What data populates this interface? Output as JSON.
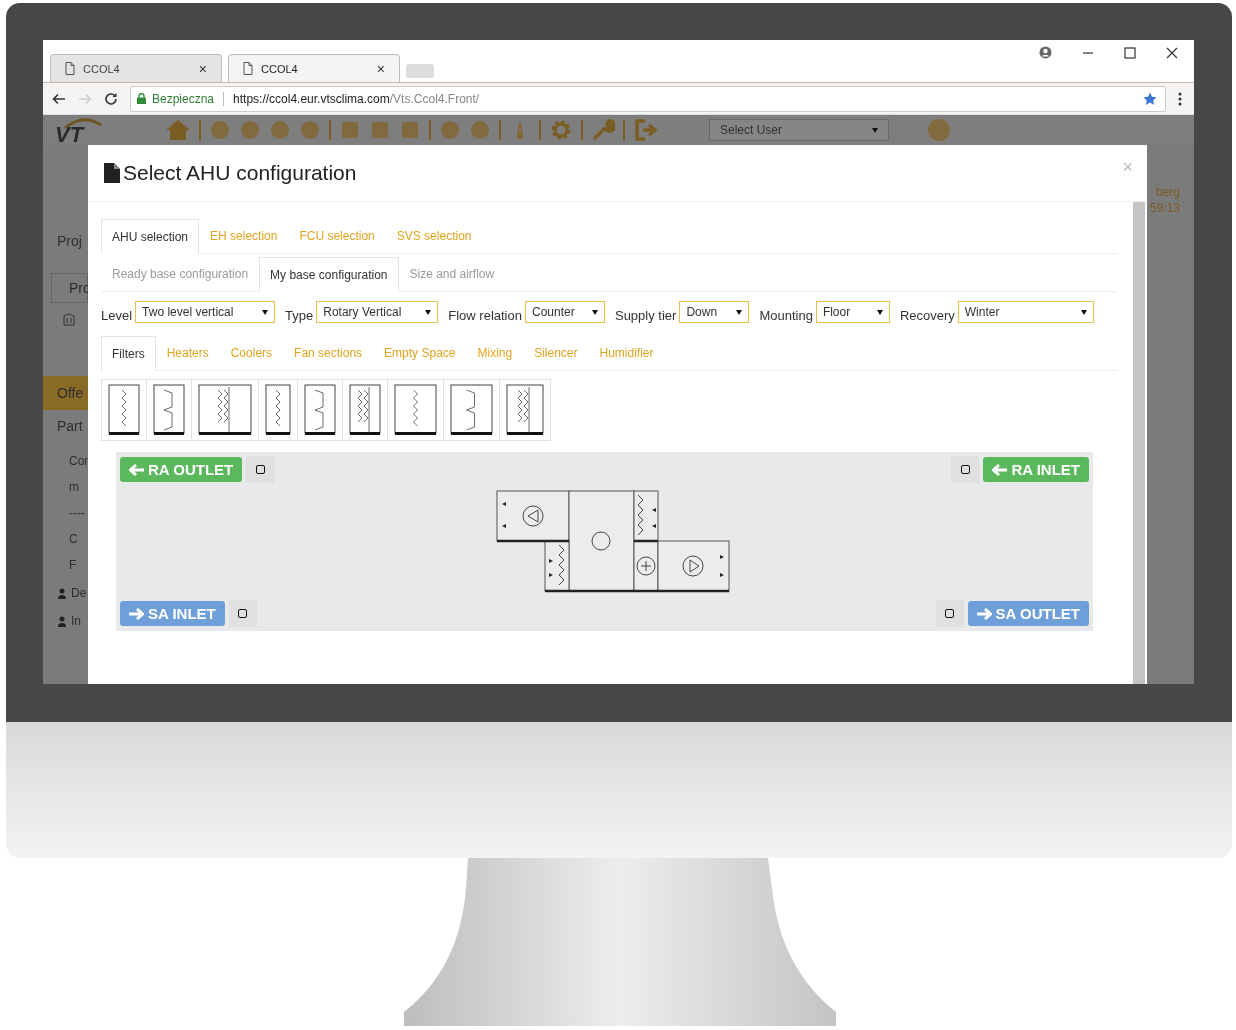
{
  "browser": {
    "tabs": [
      {
        "title": "CCOL4",
        "selected": false,
        "close": "×"
      },
      {
        "title": "CCOL4",
        "selected": true,
        "close": "×"
      }
    ],
    "security_label": "Bezpieczna",
    "url_host": "https://ccol4.eur.vtsclima.com",
    "url_path": "/Vts.Ccol4.Front/"
  },
  "app": {
    "logo": "VT",
    "select_user": "Select User",
    "corner_texts": [
      "berg",
      "59:13"
    ],
    "sidebar": [
      {
        "kind": "heading",
        "label": "Proj"
      },
      {
        "kind": "field",
        "label": "Pro"
      },
      {
        "kind": "building"
      },
      {
        "kind": "active",
        "label": "Offe"
      },
      {
        "kind": "heading",
        "label": "Part"
      },
      {
        "kind": "text",
        "label": "Con"
      },
      {
        "kind": "text",
        "label": "m"
      },
      {
        "kind": "text",
        "label": "----"
      },
      {
        "kind": "text",
        "label": "C"
      },
      {
        "kind": "text",
        "label": "F"
      },
      {
        "kind": "person",
        "label": "De"
      },
      {
        "kind": "people",
        "label": "In"
      }
    ]
  },
  "modal": {
    "title": "Select AHU configuration",
    "close": "×",
    "main_tabs": [
      {
        "label": "AHU selection",
        "selected": true
      },
      {
        "label": "EH selection",
        "selected": false
      },
      {
        "label": "FCU selection",
        "selected": false
      },
      {
        "label": "SVS selection",
        "selected": false
      }
    ],
    "sub_tabs": [
      {
        "label": "Ready base configuration",
        "selected": false,
        "disabled": true
      },
      {
        "label": "My base configuration",
        "selected": true,
        "disabled": false
      },
      {
        "label": "Size and airflow",
        "selected": false,
        "disabled": true
      }
    ],
    "options": [
      {
        "label": "Level",
        "value": "Two level vertical"
      },
      {
        "label": "Type",
        "value": "Rotary Vertical"
      },
      {
        "label": "Flow relation",
        "value": "Counter"
      },
      {
        "label": "Supply tier",
        "value": "Down"
      },
      {
        "label": "Mounting",
        "value": "Floor"
      },
      {
        "label": "Recovery",
        "value": "Winter"
      }
    ],
    "section_tabs": [
      {
        "label": "Filters",
        "selected": true
      },
      {
        "label": "Heaters",
        "selected": false
      },
      {
        "label": "Coolers",
        "selected": false
      },
      {
        "label": "Fan sections",
        "selected": false
      },
      {
        "label": "Empty Space",
        "selected": false
      },
      {
        "label": "Mixing",
        "selected": false
      },
      {
        "label": "Silencer",
        "selected": false
      },
      {
        "label": "Humidifier",
        "selected": false
      }
    ],
    "ports": [
      {
        "label": "RA OUTLET",
        "kind": "left",
        "color": "#5cb85c"
      },
      {
        "label": "RA INLET",
        "kind": "left",
        "color": "#5cb85c"
      },
      {
        "label": "SA INLET",
        "kind": "right",
        "color": "#6f9fd8"
      },
      {
        "label": "SA OUTLET",
        "kind": "right",
        "color": "#6f9fd8"
      }
    ]
  }
}
